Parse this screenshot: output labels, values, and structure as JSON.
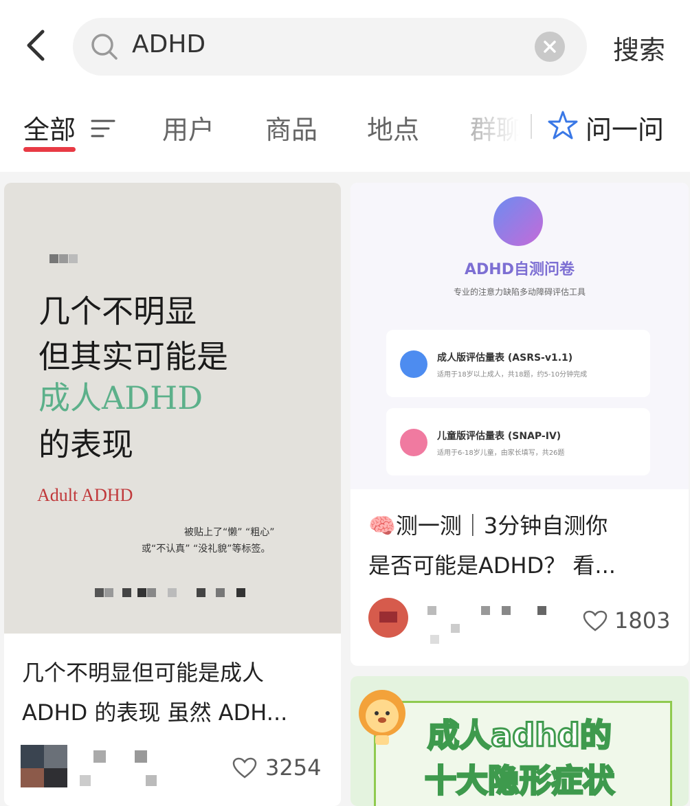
{
  "search": {
    "query": "ADHD",
    "button_label": "搜索"
  },
  "tabs": [
    {
      "label": "全部"
    },
    {
      "label": "用户"
    },
    {
      "label": "商品"
    },
    {
      "label": "地点"
    },
    {
      "label": "群聊"
    }
  ],
  "ask": {
    "label": "问一问"
  },
  "colors": {
    "accent": "#e83a44",
    "green_text": "#5cb08a",
    "adult_red": "#c0393b",
    "brand_purple": "#7d6fd3"
  },
  "posts": [
    {
      "cover": {
        "lines": [
          "几个不明显",
          "但其实可能是",
          "成人ADHD",
          "的表现"
        ],
        "adult": "Adult ADHD",
        "small1": "被贴上了“懒” “粗心”",
        "small2": "或“不认真” “没礼貌”等标签。"
      },
      "title_line1": "几个不明显但可能是成人",
      "title_line2": "ADHD 的表现 虽然 ADH...",
      "likes": "3254"
    },
    {
      "cover": {
        "title": "ADHD自测问卷",
        "subtitle": "专业的注意力缺陷多动障碍评估工具",
        "options": [
          {
            "title": "成人版评估量表 (ASRS-v1.1)",
            "desc": "适用于18岁以上成人，共18题，约5-10分钟完成",
            "icon": "adult-icon"
          },
          {
            "title": "儿童版评估量表 (SNAP-IV)",
            "desc": "适用于6-18岁儿童，由家长填写，共26题",
            "icon": "child-icon"
          }
        ]
      },
      "title_line1": "🧠测一测｜3分钟自测你",
      "title_line2": "是否可能是ADHD？ 看...",
      "likes": "1803"
    },
    {
      "cover": {
        "line1": "成人adhd的",
        "line2": "十大隐形症状"
      }
    }
  ]
}
